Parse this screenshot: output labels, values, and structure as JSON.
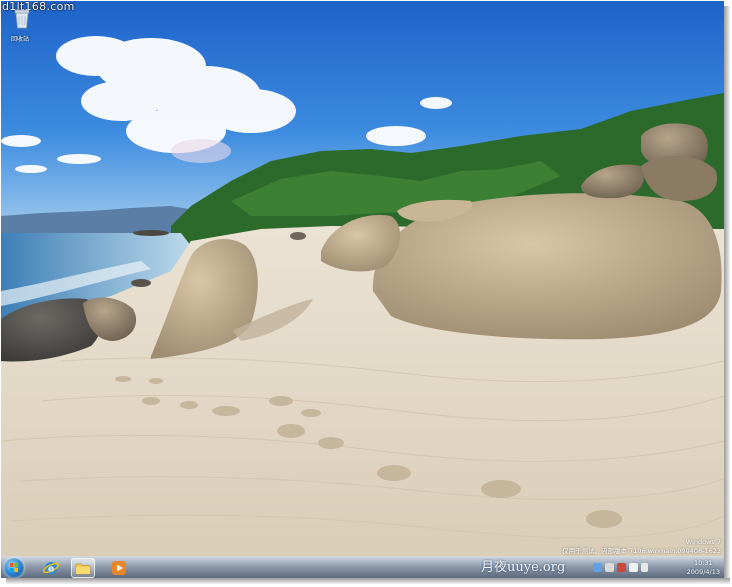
{
  "watermark_top": "d1lt168.com",
  "desktop": {
    "icons": [
      {
        "name": "recycle-bin",
        "label": "回收站",
        "icon": "recycle-bin-icon"
      }
    ],
    "build_info": {
      "line1": "Windows 7",
      "line2": "仅用于测试。内部版本 7106.winmain.090408-1623"
    }
  },
  "taskbar": {
    "start_icon": "windows-start-orb",
    "pinned": [
      {
        "name": "internet-explorer",
        "icon": "ie-icon",
        "active": false
      },
      {
        "name": "windows-explorer",
        "icon": "folder-icon",
        "active": true
      },
      {
        "name": "media-player",
        "icon": "media-player-icon",
        "active": false
      }
    ],
    "watermark": "月夜uuye.org",
    "clock": {
      "time": "10:31",
      "date": "2009/4/13"
    }
  },
  "colors": {
    "sky": "#2f7fd8",
    "sand": "#e6dccb",
    "sea": "#3f7fb5",
    "hills": "#2d6b2c",
    "rock": "#b9a78d"
  }
}
